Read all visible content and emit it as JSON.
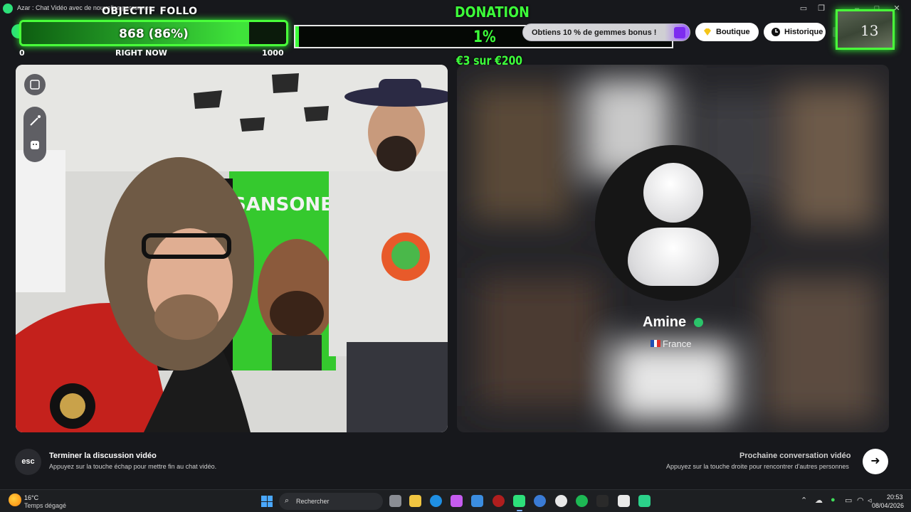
{
  "window": {
    "title": "Azar : Chat Vidéo avec de nouvelles personnes",
    "controls": [
      "video-icon",
      "window-icon",
      "minimize-icon",
      "maximize-icon",
      "close-icon"
    ]
  },
  "follower_goal": {
    "title": "OBJECTIF FOLLO",
    "value_text": "868 (86%)",
    "current": 868,
    "goal": 1000,
    "percent": 86,
    "min_label": "0",
    "caption": "RIGHT NOW",
    "max_label": "1000"
  },
  "donation": {
    "title": "DONATION",
    "percent_text": "1%",
    "percent": 1,
    "amount_text": "€3 sur €200"
  },
  "header": {
    "gems_promo": "Obtiens 10 % de gemmes bonus !",
    "shop_label": "Boutique",
    "history_label": "Historique",
    "cam_counter": "13"
  },
  "left_video": {
    "wall_text": "SANSONET",
    "tools": [
      "expand-icon",
      "magic-wand-icon",
      "face-filter-icon"
    ]
  },
  "peer": {
    "name": "Amine",
    "country": "France",
    "verified": true
  },
  "bottom": {
    "esc_key": "esc",
    "end_title": "Terminer la discussion vidéo",
    "end_desc": "Appuyez sur la touche échap pour mettre fin au chat vidéo.",
    "next_title": "Prochaine conversation vidéo",
    "next_desc": "Appuyez sur la touche droite pour rencontrer d'autres personnes"
  },
  "taskbar": {
    "weather_temp": "16°C",
    "weather_desc": "Temps dégagé",
    "search_placeholder": "Rechercher",
    "time": "20:53",
    "date": "08/04/2026"
  },
  "colors": {
    "overlay_green": "#3dff3a",
    "app_background": "#17181c",
    "verified_green": "#2bc46a",
    "gems_purple": "#7d2cf0"
  }
}
